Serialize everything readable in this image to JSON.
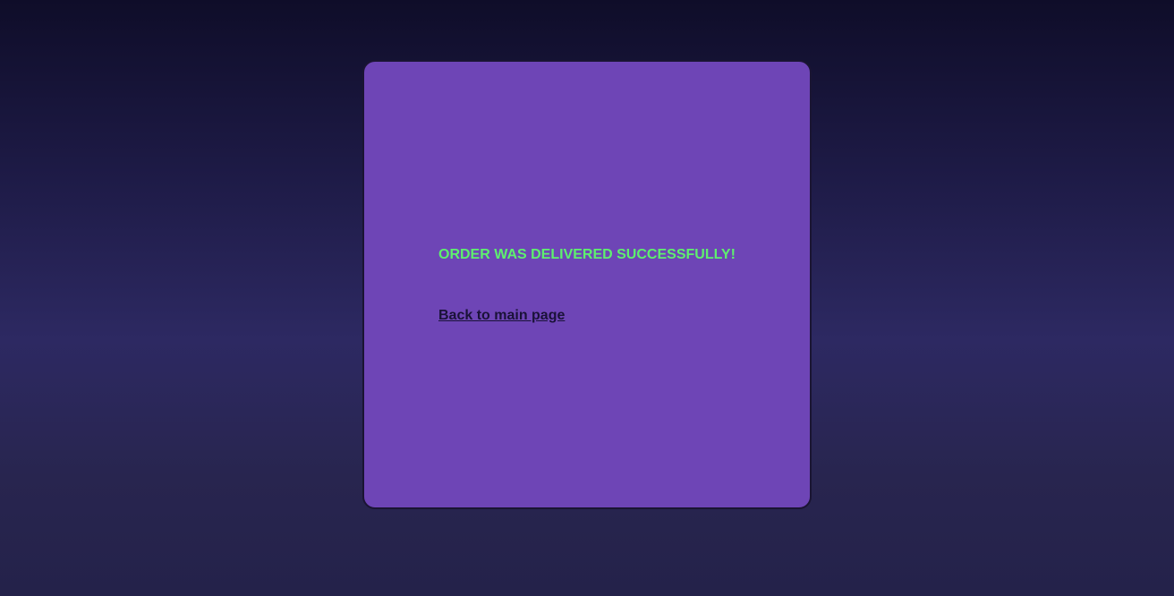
{
  "card": {
    "message": "ORDER WAS DELIVERED SUCCESSFULLY!",
    "back_link_label": "Back to main page"
  },
  "colors": {
    "card_background": "#6e45b6",
    "message_text": "#5ef06e",
    "link_text": "#1a1238"
  }
}
